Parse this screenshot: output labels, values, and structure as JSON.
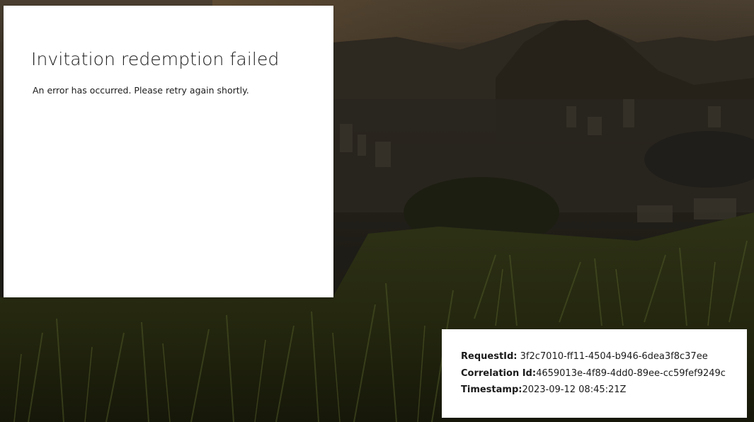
{
  "error_card": {
    "title": "Invitation redemption failed",
    "message": "An error has occurred. Please retry again shortly."
  },
  "details": {
    "request_id_label": "RequestId:",
    "request_id_value": "3f2c7010-ff11-4504-b946-6dea3f8c37ee",
    "correlation_id_label": "Correlation Id:",
    "correlation_id_value": "4659013e-4f89-4dd0-89ee-cc59fef9249c",
    "timestamp_label": "Timestamp:",
    "timestamp_value": "2023-09-12 08:45:21Z"
  },
  "colors": {
    "card_background": "#ffffff",
    "text": "#1b1b1b",
    "scene_sky": "#3a3024",
    "scene_grass": "#2a2a12"
  }
}
